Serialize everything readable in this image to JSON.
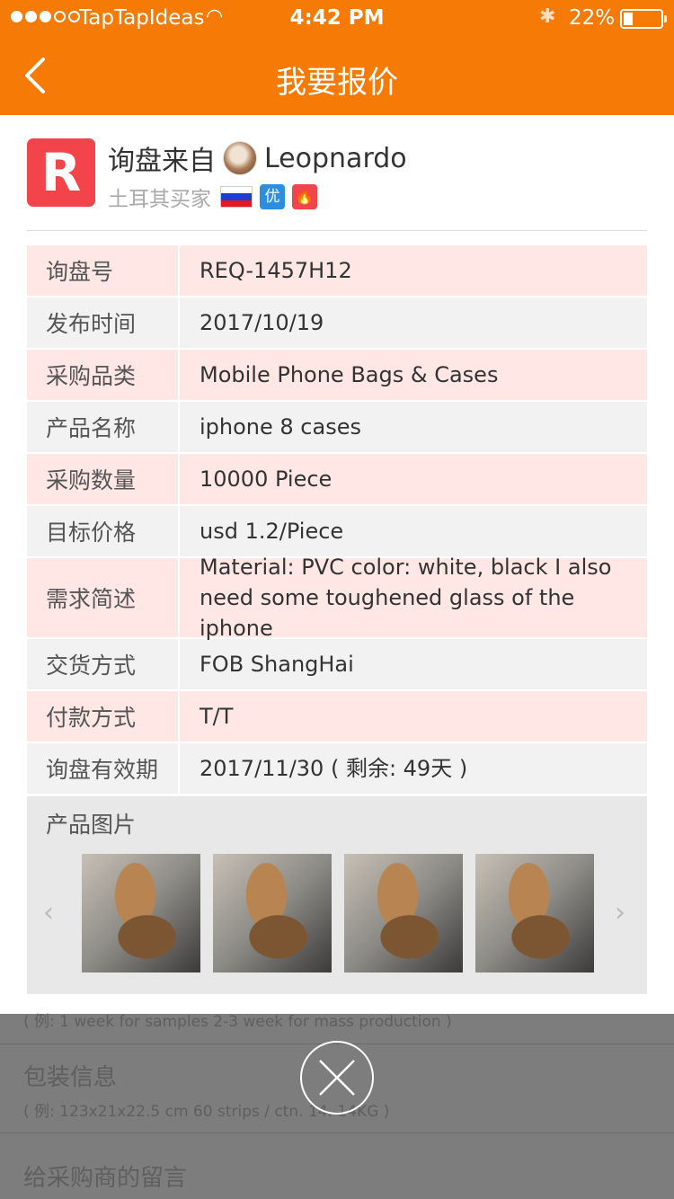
{
  "status": {
    "carrier": "TapTapIdeas",
    "time": "4:42 PM",
    "battery": "22%"
  },
  "nav": {
    "title": "我要报价"
  },
  "inquiry": {
    "logo_letter": "R",
    "from_label": "询盘来自",
    "buyer_name": "Leopnardo",
    "buyer_country": "土耳其买家",
    "badge_preferred": "优",
    "badge_hot": "🔥"
  },
  "details": [
    {
      "label": "询盘号",
      "value": "REQ-1457H12"
    },
    {
      "label": "发布时间",
      "value": "2017/10/19"
    },
    {
      "label": "采购品类",
      "value": "Mobile Phone Bags & Cases"
    },
    {
      "label": "产品名称",
      "value": "iphone 8 cases"
    },
    {
      "label": "采购数量",
      "value": "10000 Piece"
    },
    {
      "label": "目标价格",
      "value": "usd 1.2/Piece"
    },
    {
      "label": "需求简述",
      "value": "Material: PVC color: white, black I also need some toughened glass of the iphone"
    },
    {
      "label": "交货方式",
      "value": "FOB ShangHai"
    },
    {
      "label": "付款方式",
      "value": "T/T"
    },
    {
      "label": "询盘有效期",
      "value": "2017/11/30 ( 剩余: 49天 )"
    }
  ],
  "photos": {
    "title": "产品图片",
    "count": 4
  },
  "underlay": {
    "delivery_hint": "( 例: 1 week for samples 2-3 week for mass production )",
    "packaging_label": "包装信息",
    "packaging_hint": "( 例: 123x21x22.5 cm 60 strips / ctn. 14. 14KG )",
    "message_label": "给采购商的留言"
  },
  "colors": {
    "accent": "#f57b06",
    "logo": "#f4444b",
    "row_pink": "#ffe7e6",
    "row_gray": "#f2f2f2"
  }
}
